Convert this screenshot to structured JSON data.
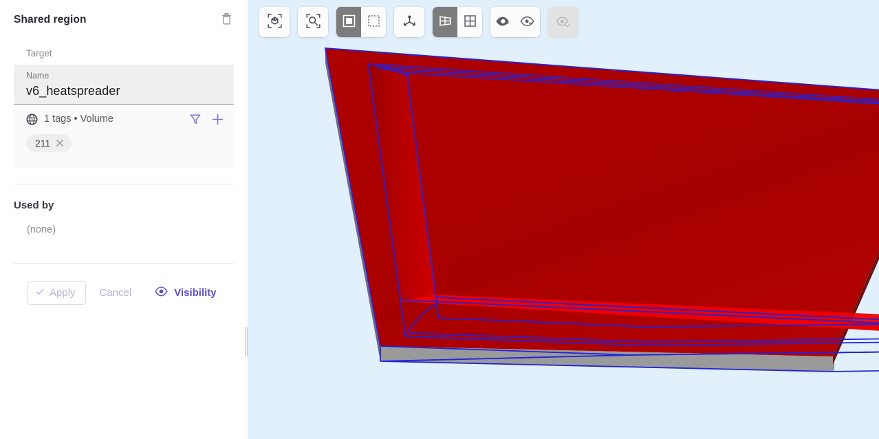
{
  "sidebar": {
    "title": "Shared region",
    "delete_icon": "trash-icon",
    "target_label": "Target",
    "name_label": "Name",
    "name_value": "v6_heatspreader",
    "tag_summary": "1 tags • Volume",
    "globe_icon": "globe-icon",
    "filter_icon": "filter-funnel-icon",
    "add_icon": "plus-icon",
    "tags": [
      {
        "label": "211",
        "remove_icon": "close-icon"
      }
    ],
    "used_by_heading": "Used by",
    "used_by_value": "(none)",
    "actions": {
      "apply_label": "Apply",
      "apply_icon": "check-icon",
      "apply_enabled": false,
      "cancel_label": "Cancel",
      "cancel_enabled": false,
      "visibility_label": "Visibility",
      "visibility_icon": "eye-icon"
    }
  },
  "viewport": {
    "background_color": "#e1f0fb",
    "toolbar": [
      {
        "name": "fit-to-view-button",
        "icon": "cube-focus-icon",
        "active": false,
        "disabled": false
      },
      {
        "name": "zoom-to-selection-button",
        "icon": "magnifier-focus-icon",
        "active": false,
        "disabled": false
      },
      {
        "name": "solid-select-button",
        "icon": "filled-square-icon",
        "active": true,
        "disabled": false
      },
      {
        "name": "box-select-button",
        "icon": "dashed-square-icon",
        "active": false,
        "disabled": false
      },
      {
        "name": "axes-gizmo-button",
        "icon": "coordinate-axes-icon",
        "active": false,
        "disabled": false
      },
      {
        "name": "perspective-view-button",
        "icon": "perspective-grid-icon",
        "active": true,
        "disabled": false
      },
      {
        "name": "orthographic-view-button",
        "icon": "ortho-grid-icon",
        "active": false,
        "disabled": false
      },
      {
        "name": "show-all-button",
        "icon": "eye-solid-icon",
        "active": false,
        "disabled": false
      },
      {
        "name": "hide-others-button",
        "icon": "eye-outline-icon",
        "active": false,
        "disabled": false
      },
      {
        "name": "reset-visibility-button",
        "icon": "eye-reset-icon",
        "active": false,
        "disabled": true
      }
    ],
    "model": {
      "name": "heatspreader-3d-model",
      "top_face_color": "#b00000",
      "inner_face_color": "#e50000",
      "base_color": "#9a9a9a",
      "edge_color": "#2222dd",
      "side_color": "#6e6e6e"
    }
  },
  "colors": {
    "accent_purple": "#5b4fc9",
    "accent_purple_muted": "#b8b3d8",
    "toolbar_active": "#7c7c7c"
  }
}
